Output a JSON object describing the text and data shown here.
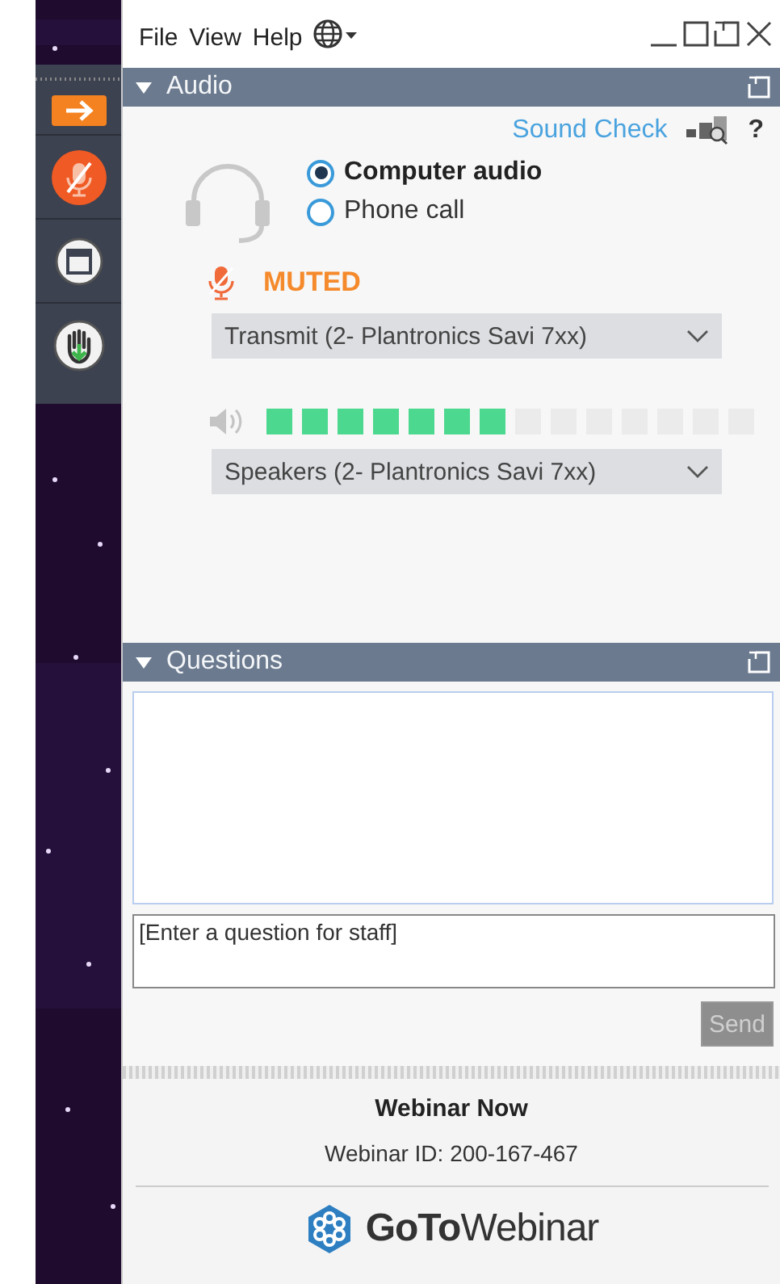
{
  "menu": [
    "File",
    "View",
    "Help"
  ],
  "audio": {
    "title": "Audio",
    "sound_check": "Sound Check",
    "help": "?",
    "options": [
      {
        "label": "Computer audio",
        "selected": true
      },
      {
        "label": "Phone call",
        "selected": false
      }
    ],
    "mic_status": "MUTED",
    "transmit": "Transmit (2- Plantronics Savi 7xx)",
    "speaker_meter": {
      "level": 0.5
    },
    "speakers": "Speakers (2- Plantronics Savi 7xx)"
  },
  "questions": {
    "title": "Questions",
    "placeholder": "[Enter a question for staff]",
    "send": {
      "label": "Send",
      "disabled": true
    }
  },
  "footer": {
    "title": "Webinar Now",
    "webinar_id": "Webinar ID: 200-167-467",
    "logo": "**GoTo**Webinar"
  }
}
